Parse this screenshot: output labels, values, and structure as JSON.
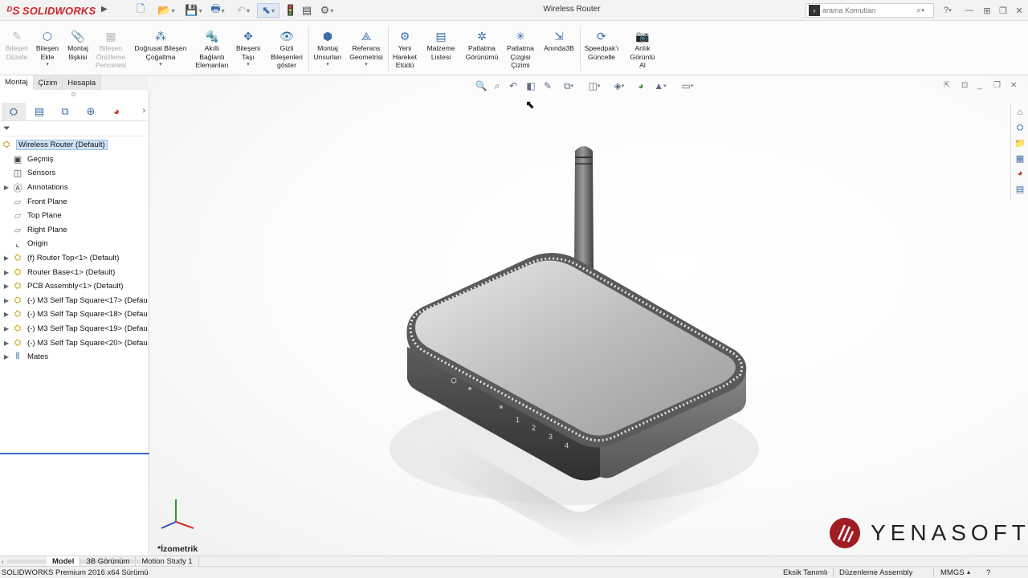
{
  "window": {
    "app_name": "SOLIDWORKS",
    "title": "Wireless Router"
  },
  "search": {
    "placeholder": "arama Komutları"
  },
  "ribbon": {
    "buttons": [
      {
        "label": "Bileşen\nDüzele",
        "disabled": true
      },
      {
        "label": "Bileşen\nEkle",
        "disabled": false
      },
      {
        "label": "Montaj\nİlişkisi",
        "disabled": false
      },
      {
        "label": "Bileşen\nÖnizleme\nPenceresi",
        "disabled": true
      },
      {
        "label": "Doğrusal Bileşen\nÇoğaltma",
        "disabled": false
      },
      {
        "label": "Akıllı\nBağlantı\nElemanları",
        "disabled": false
      },
      {
        "label": "Bileşeni\nTaşı",
        "disabled": false
      },
      {
        "label": "Gizli\nBileşenleri\ngöster",
        "disabled": false
      },
      {
        "label": "Montaj\nUnsurları",
        "disabled": false
      },
      {
        "label": "Referans\nGeometrisi",
        "disabled": false
      },
      {
        "label": "Yeni\nHareket\nEtüdü",
        "disabled": false
      },
      {
        "label": "Malzeme\nListesi",
        "disabled": false
      },
      {
        "label": "Patlatma\nGörünümü",
        "disabled": false
      },
      {
        "label": "Patlatma\nÇizgisi\nÇizimi",
        "disabled": false
      },
      {
        "label": "Anında3B",
        "disabled": false
      },
      {
        "label": "Speedpak'ı\nGüncelle",
        "disabled": false
      },
      {
        "label": "Anlık\nGörüntü\nAl",
        "disabled": false
      }
    ]
  },
  "command_tabs": [
    "Montaj",
    "Çizim",
    "Hesapla"
  ],
  "tree": {
    "root": "Wireless Router  (Default)",
    "items": [
      {
        "label": "Geçmiş",
        "icon": "history-icon",
        "expandable": false
      },
      {
        "label": "Sensors",
        "icon": "sensors-icon",
        "expandable": false
      },
      {
        "label": "Annotations",
        "icon": "annotations-icon",
        "expandable": true
      },
      {
        "label": "Front Plane",
        "icon": "plane-icon",
        "expandable": false
      },
      {
        "label": "Top Plane",
        "icon": "plane-icon",
        "expandable": false
      },
      {
        "label": "Right Plane",
        "icon": "plane-icon",
        "expandable": false
      },
      {
        "label": "Origin",
        "icon": "origin-icon",
        "expandable": false
      },
      {
        "label": "(f) Router Top<1> (Default)",
        "icon": "part-icon",
        "expandable": true
      },
      {
        "label": "Router Base<1> (Default)",
        "icon": "part-icon",
        "expandable": true
      },
      {
        "label": "PCB Assembly<1> (Default)",
        "icon": "part-icon",
        "expandable": true
      },
      {
        "label": "(-) M3 Self Tap Square<17> (Defau",
        "icon": "fastener-icon",
        "expandable": true
      },
      {
        "label": "(-) M3 Self Tap Square<18> (Defau",
        "icon": "fastener-icon",
        "expandable": true
      },
      {
        "label": "(-) M3 Self Tap Square<19> (Defau",
        "icon": "fastener-icon",
        "expandable": true
      },
      {
        "label": "(-) M3 Self Tap Square<20> (Defau",
        "icon": "fastener-icon",
        "expandable": true
      },
      {
        "label": "Mates",
        "icon": "mates-icon",
        "expandable": true
      }
    ]
  },
  "viewport": {
    "view_name": "*İzometrik",
    "watermark": "YENASOFT",
    "router_label": [
      "1",
      "2",
      "3",
      "4"
    ]
  },
  "bottom_tabs": [
    "Model",
    "3B Görünüm",
    "Motion Study 1"
  ],
  "status": {
    "version": "SOLIDWORKS Premium 2016 x64 Sürümü",
    "definition": "Eksik Tanımlı",
    "mode": "Düzenleme Assembly",
    "units": "MMGS"
  },
  "colors": {
    "brand_red": "#d0232a",
    "selection_blue": "#cfe3f7",
    "accent_blue": "#2f6fbd"
  }
}
